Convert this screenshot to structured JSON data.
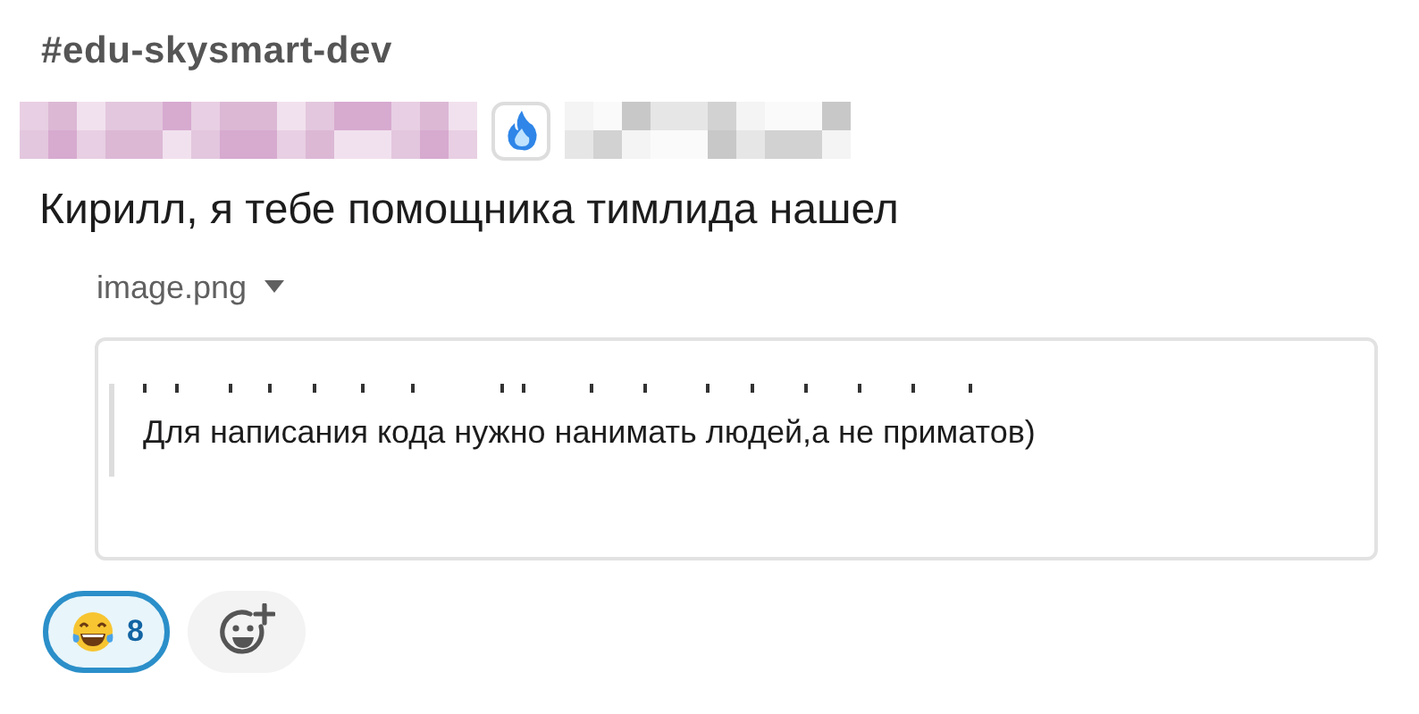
{
  "channel": {
    "title": "#edu-skysmart-dev"
  },
  "message": {
    "text": "Кирилл, я тебе помощника тимлида нашел",
    "attachment": {
      "file_name": "image.png",
      "expanded": true,
      "quote": "Для написания кода нужно нанимать людей,а не приматов)"
    }
  },
  "reactions": [
    {
      "kind": "emoji",
      "count": "8",
      "selected": true
    },
    {
      "kind": "add"
    }
  ]
}
